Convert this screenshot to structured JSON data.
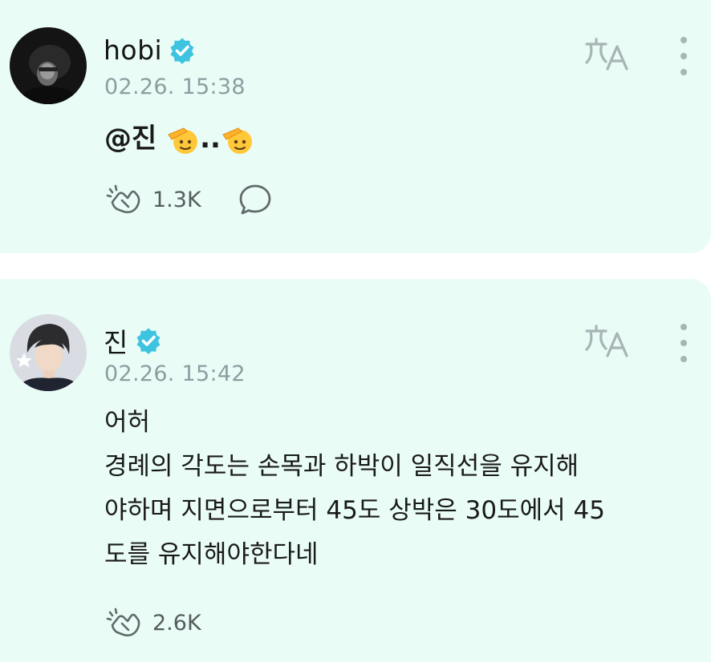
{
  "posts": [
    {
      "author": "hobi",
      "timestamp": "02.26. 15:38",
      "mention": "@진",
      "separator": "..",
      "reactions": "1.3K"
    },
    {
      "author": "진",
      "timestamp": "02.26. 15:42",
      "lines": [
        "어허",
        "경례의 각도는 손목과 하박이 일직선을 유지해",
        "야하며 지면으로부터 45도 상박은 30도에서 45",
        "도를 유지해야한다네"
      ],
      "reactions": "2.6K"
    }
  ],
  "colors": {
    "card_background": "#e9fcf6",
    "verified_badge": "#3ec3e0",
    "icon_gray": "#a8b4b5",
    "text_primary": "#1a1a1a",
    "text_secondary": "#8c9ea0"
  },
  "icons": {
    "verified": "verified-badge-icon",
    "translate": "translate-icon",
    "more": "more-vertical-icon",
    "reaction": "clapping-hands-icon",
    "comment": "comment-bubble-icon",
    "emoji": "saluting-face-emoji"
  }
}
